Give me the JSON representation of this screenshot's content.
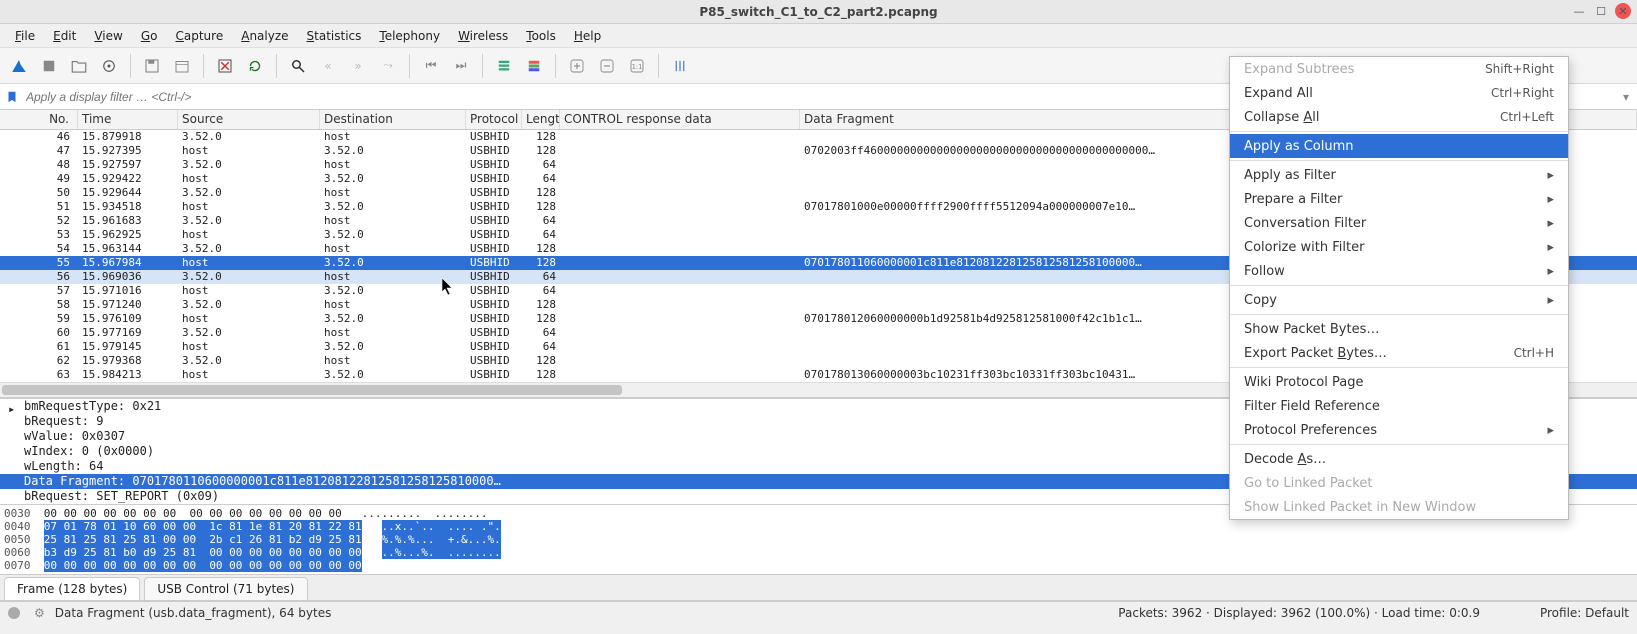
{
  "window": {
    "title": "P85_switch_C1_to_C2_part2.pcapng"
  },
  "menubar": [
    "File",
    "Edit",
    "View",
    "Go",
    "Capture",
    "Analyze",
    "Statistics",
    "Telephony",
    "Wireless",
    "Tools",
    "Help"
  ],
  "filter_placeholder": "Apply a display filter … <Ctrl-/>",
  "columns": [
    "No.",
    "Time",
    "Source",
    "Destination",
    "Protocol",
    "Length",
    "CONTROL response data",
    "Data Fragment"
  ],
  "packets": [
    {
      "no": "46",
      "time": "15.879918",
      "src": "3.52.0",
      "dst": "host",
      "proto": "USBHID",
      "len": "128",
      "ctrl": "",
      "frag": ""
    },
    {
      "no": "47",
      "time": "15.927395",
      "src": "host",
      "dst": "3.52.0",
      "proto": "USBHID",
      "len": "128",
      "ctrl": "",
      "frag": "0702003ff4600000000000000000000000000000000000000000…"
    },
    {
      "no": "48",
      "time": "15.927597",
      "src": "3.52.0",
      "dst": "host",
      "proto": "USBHID",
      "len": "64",
      "ctrl": "",
      "frag": ""
    },
    {
      "no": "49",
      "time": "15.929422",
      "src": "host",
      "dst": "3.52.0",
      "proto": "USBHID",
      "len": "64",
      "ctrl": "",
      "frag": ""
    },
    {
      "no": "50",
      "time": "15.929644",
      "src": "3.52.0",
      "dst": "host",
      "proto": "USBHID",
      "len": "128",
      "ctrl": "",
      "frag": ""
    },
    {
      "no": "51",
      "time": "15.934518",
      "src": "host",
      "dst": "3.52.0",
      "proto": "USBHID",
      "len": "128",
      "ctrl": "",
      "frag": "07017801000e00000ffff2900ffff5512094a000000007e10…"
    },
    {
      "no": "52",
      "time": "15.961683",
      "src": "3.52.0",
      "dst": "host",
      "proto": "USBHID",
      "len": "64",
      "ctrl": "",
      "frag": ""
    },
    {
      "no": "53",
      "time": "15.962925",
      "src": "host",
      "dst": "3.52.0",
      "proto": "USBHID",
      "len": "64",
      "ctrl": "",
      "frag": ""
    },
    {
      "no": "54",
      "time": "15.963144",
      "src": "3.52.0",
      "dst": "host",
      "proto": "USBHID",
      "len": "128",
      "ctrl": "",
      "frag": ""
    },
    {
      "no": "55",
      "time": "15.967984",
      "src": "host",
      "dst": "3.52.0",
      "proto": "USBHID",
      "len": "128",
      "ctrl": "",
      "frag": "070178011060000001c811e812081228125812581258100000…",
      "selected": true
    },
    {
      "no": "56",
      "time": "15.969036",
      "src": "3.52.0",
      "dst": "host",
      "proto": "USBHID",
      "len": "64",
      "ctrl": "",
      "frag": "",
      "secondary": true
    },
    {
      "no": "57",
      "time": "15.971016",
      "src": "host",
      "dst": "3.52.0",
      "proto": "USBHID",
      "len": "64",
      "ctrl": "",
      "frag": ""
    },
    {
      "no": "58",
      "time": "15.971240",
      "src": "3.52.0",
      "dst": "host",
      "proto": "USBHID",
      "len": "128",
      "ctrl": "",
      "frag": ""
    },
    {
      "no": "59",
      "time": "15.976109",
      "src": "host",
      "dst": "3.52.0",
      "proto": "USBHID",
      "len": "128",
      "ctrl": "",
      "frag": "070178012060000000b1d92581b4d925812581000f42c1b1c1…"
    },
    {
      "no": "60",
      "time": "15.977169",
      "src": "3.52.0",
      "dst": "host",
      "proto": "USBHID",
      "len": "64",
      "ctrl": "",
      "frag": ""
    },
    {
      "no": "61",
      "time": "15.979145",
      "src": "host",
      "dst": "3.52.0",
      "proto": "USBHID",
      "len": "64",
      "ctrl": "",
      "frag": ""
    },
    {
      "no": "62",
      "time": "15.979368",
      "src": "3.52.0",
      "dst": "host",
      "proto": "USBHID",
      "len": "128",
      "ctrl": "",
      "frag": ""
    },
    {
      "no": "63",
      "time": "15.984213",
      "src": "host",
      "dst": "3.52.0",
      "proto": "USBHID",
      "len": "128",
      "ctrl": "",
      "frag": "070178013060000003bc10231ff303bc10331ff303bc10431…"
    }
  ],
  "details": [
    {
      "text": "bmRequestType: 0x21",
      "exp": true
    },
    {
      "text": "bRequest: 9"
    },
    {
      "text": "wValue: 0x0307"
    },
    {
      "text": "wIndex: 0 (0x0000)"
    },
    {
      "text": "wLength: 64"
    },
    {
      "text": "Data Fragment: 0701780110600000001c811e81208122812581258125810000…",
      "sel": true
    },
    {
      "text": "bRequest: SET_REPORT (0x09)"
    }
  ],
  "hex": [
    {
      "off": "0030",
      "bytes": "00 00 00 00 00 00 00  00 00 00 00 00 00 00 00",
      "hl": false,
      "ascii": ".........  ........"
    },
    {
      "off": "0040",
      "bytes": "07 01 78 01 10 60 00 00  1c 81 1e 81 20 81 22 81",
      "hl": true,
      "ascii": "..x..`..  .... .\"."
    },
    {
      "off": "0050",
      "bytes": "25 81 25 81 25 81 00 00  2b c1 26 81 b2 d9 25 81",
      "hl": true,
      "ascii": "%.%.%...  +.&...%."
    },
    {
      "off": "0060",
      "bytes": "b3 d9 25 81 b0 d9 25 81  00 00 00 00 00 00 00 00",
      "hl": true,
      "ascii": "..%...%.  ........"
    },
    {
      "off": "0070",
      "bytes": "00 00 00 00 00 00 00 00  00 00 00 00 00 00 00 00",
      "hl": true,
      "ascii": ""
    }
  ],
  "byte_tabs": [
    "Frame (128 bytes)",
    "USB Control (71 bytes)"
  ],
  "statusbar": {
    "left": "Data Fragment (usb.data_fragment), 64 bytes",
    "mid": "Packets: 3962 · Displayed: 3962 (100.0%) · Load time: 0:0.9",
    "right": "Profile: Default"
  },
  "context_menu": [
    {
      "label": "Expand Subtrees",
      "shortcut": "Shift+Right",
      "dis": true
    },
    {
      "label": "Expand All",
      "shortcut": "Ctrl+Right"
    },
    {
      "label": "Collapse <u>A</u>ll",
      "shortcut": "Ctrl+Left"
    },
    {
      "sep": true
    },
    {
      "label": "Apply as Column",
      "sel": true
    },
    {
      "sep": true
    },
    {
      "label": "Apply as Filter",
      "sub": true
    },
    {
      "label": "Prepare a Filter",
      "sub": true
    },
    {
      "label": "Conversation Filter",
      "sub": true
    },
    {
      "label": "Colorize with Filter",
      "sub": true
    },
    {
      "label": "Follow",
      "sub": true
    },
    {
      "sep": true
    },
    {
      "label": "Copy",
      "sub": true
    },
    {
      "sep": true
    },
    {
      "label": "Show Packet Bytes…"
    },
    {
      "label": "Export Packet <u>B</u>ytes…",
      "shortcut": "Ctrl+H"
    },
    {
      "sep": true
    },
    {
      "label": "Wiki Protocol Page"
    },
    {
      "label": "Filter Field Reference"
    },
    {
      "label": "Protocol Preferences",
      "sub": true
    },
    {
      "sep": true
    },
    {
      "label": "Decode <u>A</u>s…"
    },
    {
      "label": "Go to Linked Packet",
      "dis": true
    },
    {
      "label": "Show Linked Packet in New Window",
      "dis": true
    }
  ]
}
